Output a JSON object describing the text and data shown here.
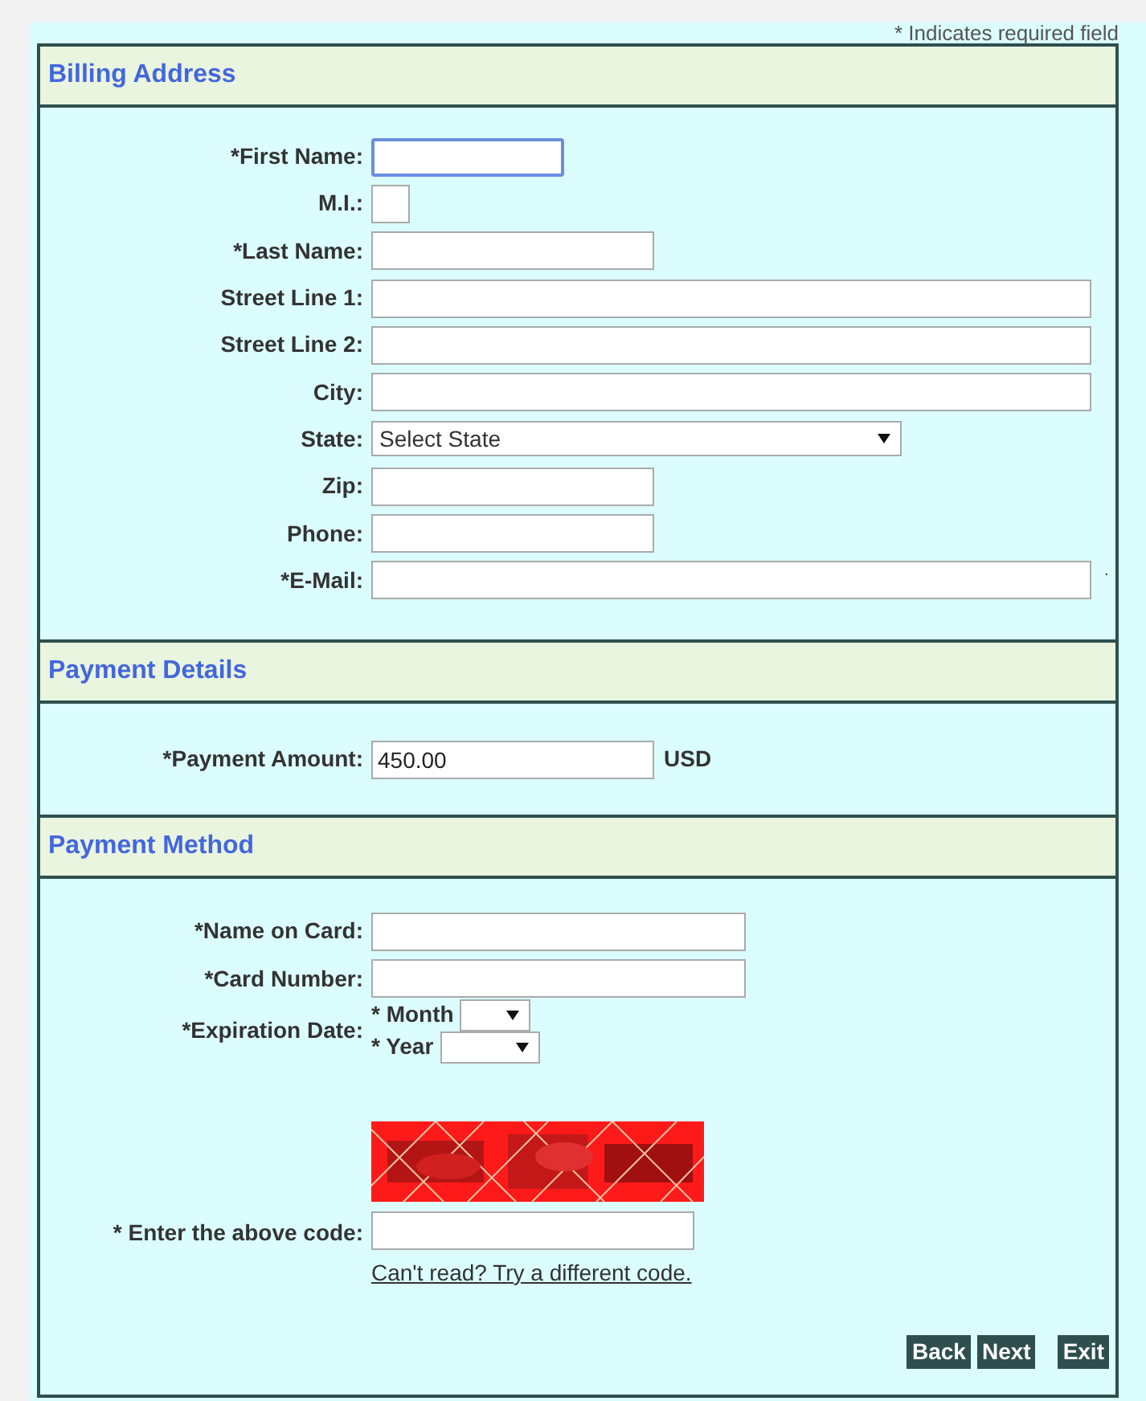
{
  "required_note": "* Indicates required field",
  "sections": [
    {
      "title": "Billing Address",
      "fields": [
        {
          "kind": "text",
          "label": "*First Name:",
          "focused": true
        },
        {
          "kind": "text",
          "label": "M.I.:",
          "focused": false
        },
        {
          "kind": "text",
          "label": "*Last Name:",
          "focused": false
        },
        {
          "kind": "text",
          "label": "Street Line 1:",
          "focused": false
        },
        {
          "kind": "text",
          "label": "Street Line 2:",
          "focused": false
        },
        {
          "kind": "text",
          "label": "City:",
          "focused": false
        },
        {
          "kind": "select",
          "label": "State:",
          "value": "Select State"
        },
        {
          "kind": "text",
          "label": "Zip:",
          "focused": false
        },
        {
          "kind": "text",
          "label": "Phone:",
          "focused": false
        },
        {
          "kind": "text",
          "label": "*E-Mail:",
          "focused": false,
          "suffix": "."
        }
      ]
    },
    {
      "title": "Payment Details",
      "fields": [
        {
          "kind": "text",
          "label": "*Payment Amount:",
          "value": "450.00",
          "focused": false,
          "unit": "USD"
        }
      ]
    },
    {
      "title": "Payment Method",
      "fields": [
        {
          "kind": "text",
          "label": "*Name on Card:",
          "focused": false
        },
        {
          "kind": "text",
          "label": "*Card Number:",
          "focused": false
        },
        {
          "kind": "expiry",
          "label": "*Expiration Date:",
          "parts": [
            {
              "label": "* Month"
            },
            {
              "label": "* Year"
            }
          ]
        },
        {
          "kind": "captcha"
        },
        {
          "kind": "text",
          "label": "* Enter the above code:",
          "focused": false,
          "link": "Can't read? Try a different code."
        }
      ]
    }
  ],
  "buttons": [
    "Back",
    "Next",
    "Exit"
  ]
}
